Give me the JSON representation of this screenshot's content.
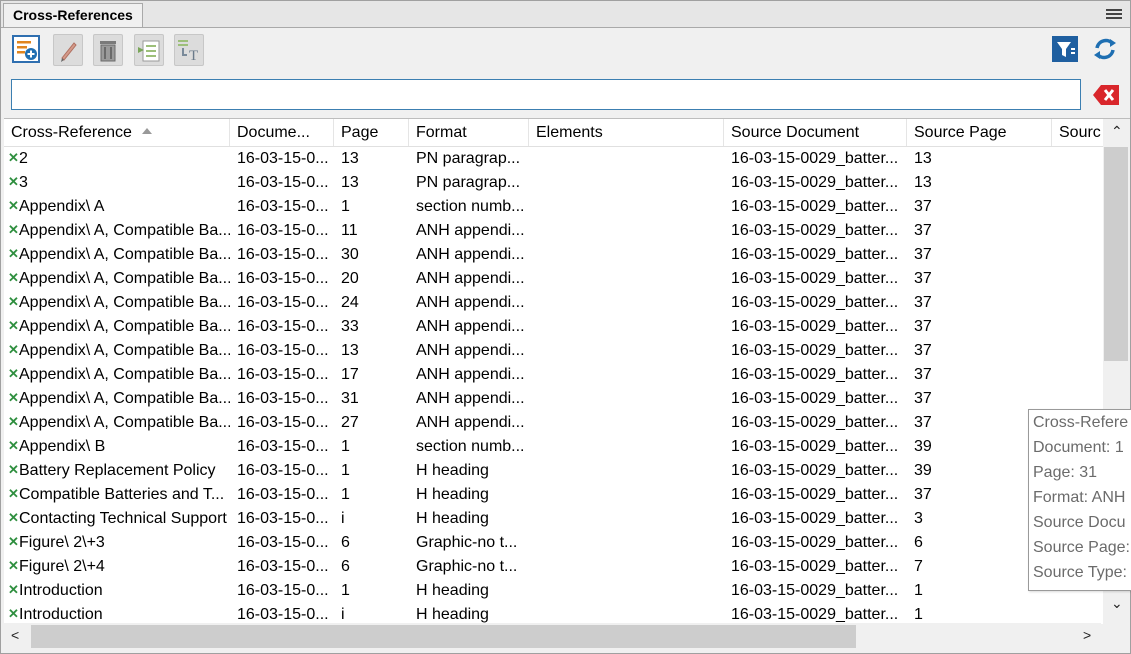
{
  "panel": {
    "title": "Cross-References"
  },
  "toolbar": {
    "icons": [
      "insert-cross-reference-icon",
      "edit-pencil-icon",
      "delete-trash-icon",
      "update-source-icon",
      "convert-to-text-icon",
      "filter-icon",
      "refresh-icon"
    ]
  },
  "search": {
    "value": "",
    "placeholder": ""
  },
  "columns": [
    "Cross-Reference",
    "Docume...",
    "Page",
    "Format",
    "Elements",
    "Source Document",
    "Source Page",
    "Sourc"
  ],
  "rows": [
    {
      "xref": "2",
      "doc": "16-03-15-0...",
      "page": "13",
      "format": "PN paragrap...",
      "elements": "",
      "src_doc": "16-03-15-0029_batter...",
      "src_page": "13"
    },
    {
      "xref": "3",
      "doc": "16-03-15-0...",
      "page": "13",
      "format": "PN paragrap...",
      "elements": "",
      "src_doc": "16-03-15-0029_batter...",
      "src_page": "13"
    },
    {
      "xref": "Appendix\\ A",
      "doc": "16-03-15-0...",
      "page": "1",
      "format": "section numb...",
      "elements": "",
      "src_doc": "16-03-15-0029_batter...",
      "src_page": "37"
    },
    {
      "xref": "Appendix\\ A, Compatible Ba...",
      "doc": "16-03-15-0...",
      "page": "11",
      "format": "ANH appendi...",
      "elements": "",
      "src_doc": "16-03-15-0029_batter...",
      "src_page": "37"
    },
    {
      "xref": "Appendix\\ A, Compatible Ba...",
      "doc": "16-03-15-0...",
      "page": "30",
      "format": "ANH appendi...",
      "elements": "",
      "src_doc": "16-03-15-0029_batter...",
      "src_page": "37"
    },
    {
      "xref": "Appendix\\ A, Compatible Ba...",
      "doc": "16-03-15-0...",
      "page": "20",
      "format": "ANH appendi...",
      "elements": "",
      "src_doc": "16-03-15-0029_batter...",
      "src_page": "37"
    },
    {
      "xref": "Appendix\\ A, Compatible Ba...",
      "doc": "16-03-15-0...",
      "page": "24",
      "format": "ANH appendi...",
      "elements": "",
      "src_doc": "16-03-15-0029_batter...",
      "src_page": "37"
    },
    {
      "xref": "Appendix\\ A, Compatible Ba...",
      "doc": "16-03-15-0...",
      "page": "33",
      "format": "ANH appendi...",
      "elements": "",
      "src_doc": "16-03-15-0029_batter...",
      "src_page": "37"
    },
    {
      "xref": "Appendix\\ A, Compatible Ba...",
      "doc": "16-03-15-0...",
      "page": "13",
      "format": "ANH appendi...",
      "elements": "",
      "src_doc": "16-03-15-0029_batter...",
      "src_page": "37"
    },
    {
      "xref": "Appendix\\ A, Compatible Ba...",
      "doc": "16-03-15-0...",
      "page": "17",
      "format": "ANH appendi...",
      "elements": "",
      "src_doc": "16-03-15-0029_batter...",
      "src_page": "37"
    },
    {
      "xref": "Appendix\\ A, Compatible Ba...",
      "doc": "16-03-15-0...",
      "page": "31",
      "format": "ANH appendi...",
      "elements": "",
      "src_doc": "16-03-15-0029_batter...",
      "src_page": "37"
    },
    {
      "xref": "Appendix\\ A, Compatible Ba...",
      "doc": "16-03-15-0...",
      "page": "27",
      "format": "ANH appendi...",
      "elements": "",
      "src_doc": "16-03-15-0029_batter...",
      "src_page": "37"
    },
    {
      "xref": "Appendix\\ B",
      "doc": "16-03-15-0...",
      "page": "1",
      "format": "section numb...",
      "elements": "",
      "src_doc": "16-03-15-0029_batter...",
      "src_page": "39"
    },
    {
      "xref": "Battery Replacement Policy",
      "doc": "16-03-15-0...",
      "page": "1",
      "format": "H heading",
      "elements": "",
      "src_doc": "16-03-15-0029_batter...",
      "src_page": "39"
    },
    {
      "xref": "Compatible Batteries and T...",
      "doc": "16-03-15-0...",
      "page": "1",
      "format": "H heading",
      "elements": "",
      "src_doc": "16-03-15-0029_batter...",
      "src_page": "37"
    },
    {
      "xref": "Contacting Technical Support",
      "doc": "16-03-15-0...",
      "page": "i",
      "format": "H heading",
      "elements": "",
      "src_doc": "16-03-15-0029_batter...",
      "src_page": "3"
    },
    {
      "xref": "Figure\\ 2\\+3",
      "doc": "16-03-15-0...",
      "page": "6",
      "format": "Graphic-no t...",
      "elements": "",
      "src_doc": "16-03-15-0029_batter...",
      "src_page": "6"
    },
    {
      "xref": "Figure\\ 2\\+4",
      "doc": "16-03-15-0...",
      "page": "6",
      "format": "Graphic-no t...",
      "elements": "",
      "src_doc": "16-03-15-0029_batter...",
      "src_page": "7"
    },
    {
      "xref": "Introduction",
      "doc": "16-03-15-0...",
      "page": "1",
      "format": "H heading",
      "elements": "",
      "src_doc": "16-03-15-0029_batter...",
      "src_page": "1"
    },
    {
      "xref": "Introduction",
      "doc": "16-03-15-0...",
      "page": "i",
      "format": "H heading",
      "elements": "",
      "src_doc": "16-03-15-0029_batter...",
      "src_page": "1"
    }
  ],
  "tooltip": {
    "lines": [
      "Cross-Refere",
      "Document: 1",
      "Page: 31",
      "Format: ANH",
      "Source Docu",
      "Source Page:",
      "Source Type:"
    ]
  },
  "scroll": {
    "up": "⌃",
    "down": "⌄",
    "left": "<",
    "right": ">"
  },
  "colors": {
    "accent": "#1f6fb2",
    "xmark": "#2f8f3f",
    "clear": "#d9262b"
  }
}
